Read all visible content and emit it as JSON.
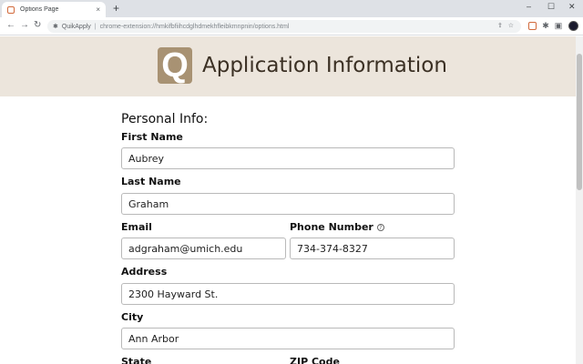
{
  "browser": {
    "tab_title": "Options Page",
    "tab_close": "×",
    "new_tab": "+",
    "win_min": "–",
    "win_max": "☐",
    "win_close": "✕",
    "nav_back": "←",
    "nav_forward": "→",
    "nav_reload": "↻",
    "ext_name": "QuikApply",
    "url_separator": "|",
    "url": "chrome-extension://hmkifbfiihcdglhdmekhfleibkmnpnin/options.html",
    "omni_share": "⇪",
    "omni_star": "☆",
    "puzzle_icon": "✱",
    "sidebar_icon": "▣"
  },
  "header": {
    "logo_letter": "Q",
    "title": "Application Information"
  },
  "form": {
    "section_title": "Personal Info:",
    "first_name": {
      "label": "First Name",
      "value": "Aubrey"
    },
    "last_name": {
      "label": "Last Name",
      "value": "Graham"
    },
    "email": {
      "label": "Email",
      "value": "adgraham@umich.edu"
    },
    "phone": {
      "label": "Phone Number",
      "help": "?",
      "value": "734-374-8327"
    },
    "address": {
      "label": "Address",
      "value": "2300 Hayward St."
    },
    "city": {
      "label": "City",
      "value": "Ann Arbor"
    },
    "state": {
      "label": "State"
    },
    "zip": {
      "label": "ZIP Code"
    }
  },
  "colors": {
    "header_bg": "#ece5dc",
    "logo_bg": "#a89273",
    "title_text": "#3b3024",
    "brand_accent": "#d26a3c"
  }
}
